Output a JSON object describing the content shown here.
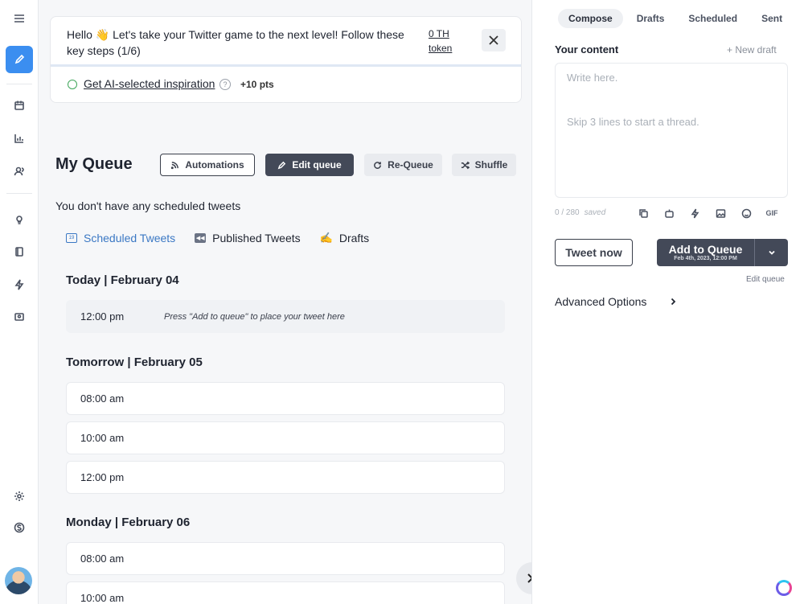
{
  "onboarding": {
    "message": "Hello 👋  Let's take your Twitter game to the next level! Follow these key steps (1/6)",
    "token_link": "0 TH token",
    "inspiration_link": "Get AI-selected inspiration",
    "help_glyph": "?",
    "points": "+10 pts"
  },
  "queue": {
    "title": "My Queue",
    "buttons": {
      "automations": "Automations",
      "edit_queue": "Edit queue",
      "requeue": "Re-Queue",
      "shuffle": "Shuffle"
    },
    "empty_message": "You don't have any scheduled tweets",
    "tabs": [
      {
        "label": "Scheduled Tweets",
        "icon": "calendar-icon",
        "active": true
      },
      {
        "label": "Published Tweets",
        "icon": "rewind-icon",
        "active": false
      },
      {
        "label": "Drafts",
        "icon": "pencil-icon",
        "active": false
      }
    ],
    "days": [
      {
        "heading": "Today | February 04",
        "slots": [
          {
            "time": "12:00 pm",
            "hint": "Press \"Add to queue\" to place your tweet here"
          }
        ]
      },
      {
        "heading": "Tomorrow | February 05",
        "slots": [
          {
            "time": "08:00 am"
          },
          {
            "time": "10:00 am"
          },
          {
            "time": "12:00 pm"
          }
        ]
      },
      {
        "heading": "Monday | February 06",
        "slots": [
          {
            "time": "08:00 am"
          },
          {
            "time": "10:00 am"
          }
        ]
      }
    ]
  },
  "composer": {
    "tabs": [
      "Compose",
      "Drafts",
      "Scheduled",
      "Sent"
    ],
    "active_tab": "Compose",
    "section_label": "Your content",
    "new_draft": "+ New draft",
    "placeholder_line1": "Write here.",
    "placeholder_line2": "Skip 3 lines to start a thread.",
    "counter": "0 / 280",
    "save_state": "saved",
    "gif_label": "GIF",
    "tweet_now": "Tweet now",
    "add_to_queue": "Add to Queue",
    "queue_time": "Feb 4th, 2023, 12:00 PM",
    "edit_queue_link": "Edit queue",
    "advanced_options": "Advanced Options"
  },
  "colors": {
    "accent": "#3b8ef0",
    "dark_button": "#434958",
    "active_tab_text": "#3b78c4"
  }
}
